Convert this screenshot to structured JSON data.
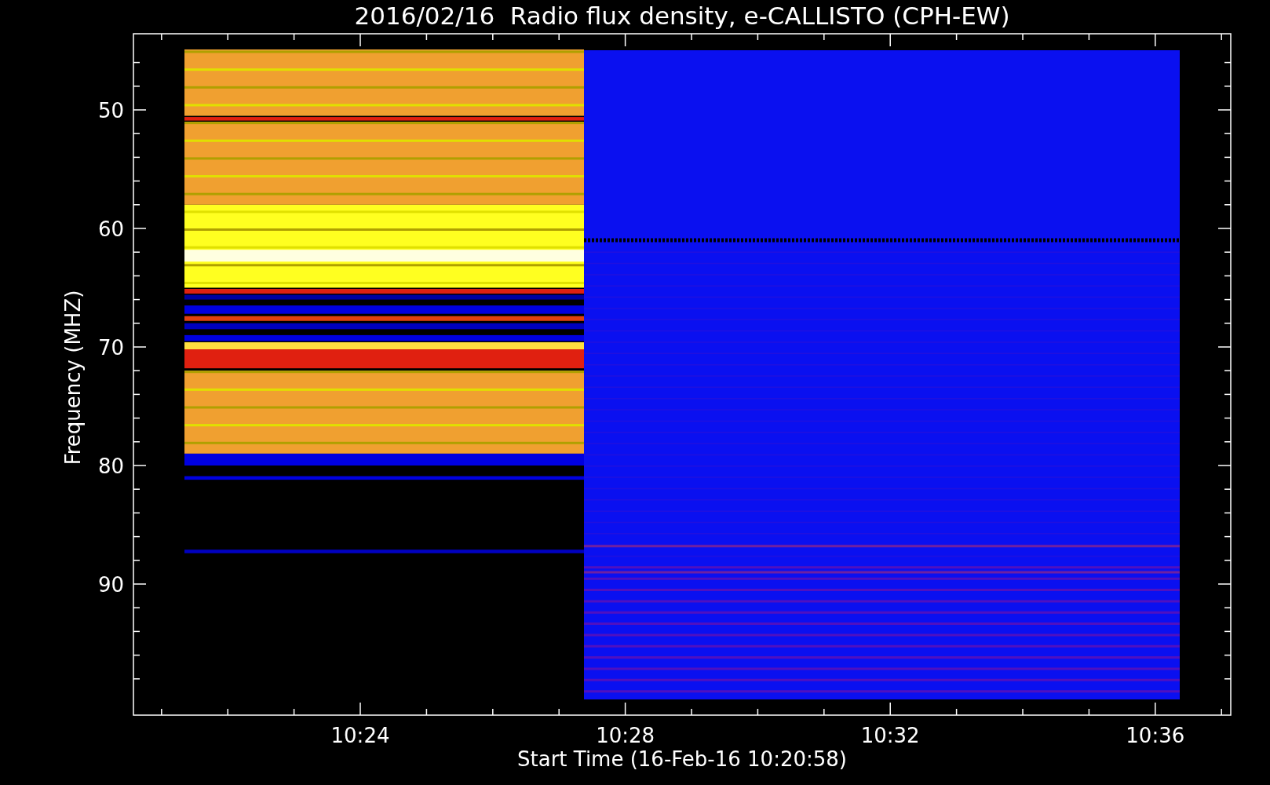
{
  "title": "2016/02/16  Radio flux density, e-CALLISTO (CPH-EW)",
  "y_axis": {
    "label": "Frequency (MHZ)",
    "ticks": [
      "50",
      "60",
      "70",
      "80",
      "90"
    ]
  },
  "x_axis": {
    "label": "Start Time (16-Feb-16 10:20:58)",
    "ticks": [
      "10:24",
      "10:28",
      "10:32",
      "10:36"
    ]
  }
}
